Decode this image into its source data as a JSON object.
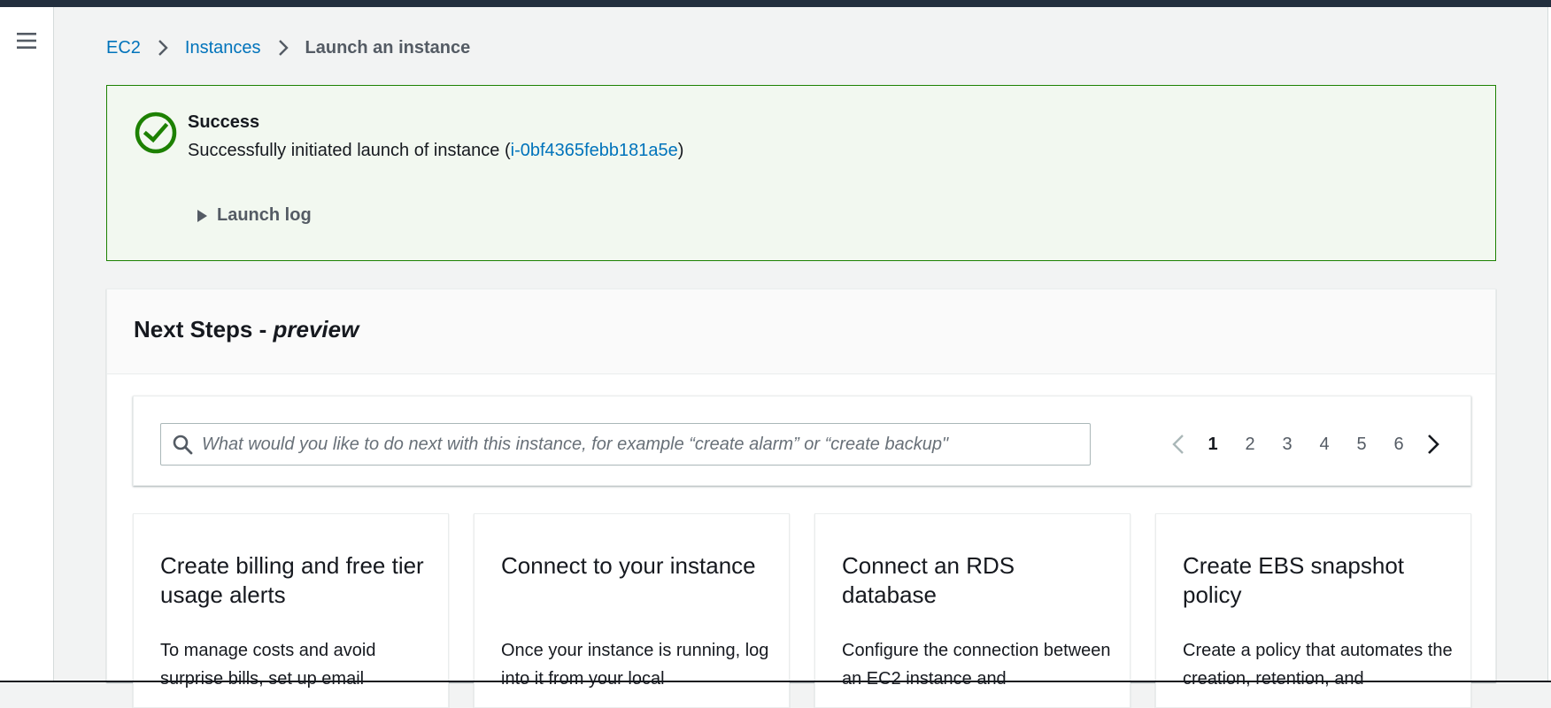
{
  "breadcrumb": {
    "items": [
      {
        "label": "EC2"
      },
      {
        "label": "Instances"
      },
      {
        "label": "Launch an instance"
      }
    ]
  },
  "alert": {
    "title": "Success",
    "message_prefix": "Successfully initiated launch of instance (",
    "instance_id": "i-0bf4365febb181a5e",
    "message_suffix": ")",
    "launch_log_label": "Launch log"
  },
  "next_steps": {
    "title": "Next Steps - ",
    "title_suffix": "preview",
    "search": {
      "value": "",
      "placeholder": "What would you like to do next with this instance, for example “create alarm” or “create backup\""
    },
    "pagination": {
      "pages": [
        "1",
        "2",
        "3",
        "4",
        "5",
        "6"
      ],
      "current": "1"
    },
    "cards": [
      {
        "title": "Create billing and free tier usage alerts",
        "description": "To manage costs and avoid surprise bills, set up email"
      },
      {
        "title": "Connect to your instance",
        "description": "Once your instance is running, log into it from your local"
      },
      {
        "title": "Connect an RDS database",
        "description": "Configure the connection between an EC2 instance and"
      },
      {
        "title": "Create EBS snapshot policy",
        "description": "Create a policy that automates the creation, retention, and"
      }
    ]
  },
  "colors": {
    "link": "#0073bb",
    "success_border": "#1d8102",
    "success_bg": "#f2f8f0",
    "top_bar": "#232f3e",
    "text": "#16191f",
    "muted": "#545b64"
  },
  "icons": {
    "menu": "hamburger-icon",
    "breadcrumb_separator": "chevron-right-icon",
    "alert": "success-check-circle-icon",
    "expand": "caret-right-icon",
    "search": "search-icon",
    "prev": "chevron-left-icon",
    "next": "chevron-right-icon"
  }
}
